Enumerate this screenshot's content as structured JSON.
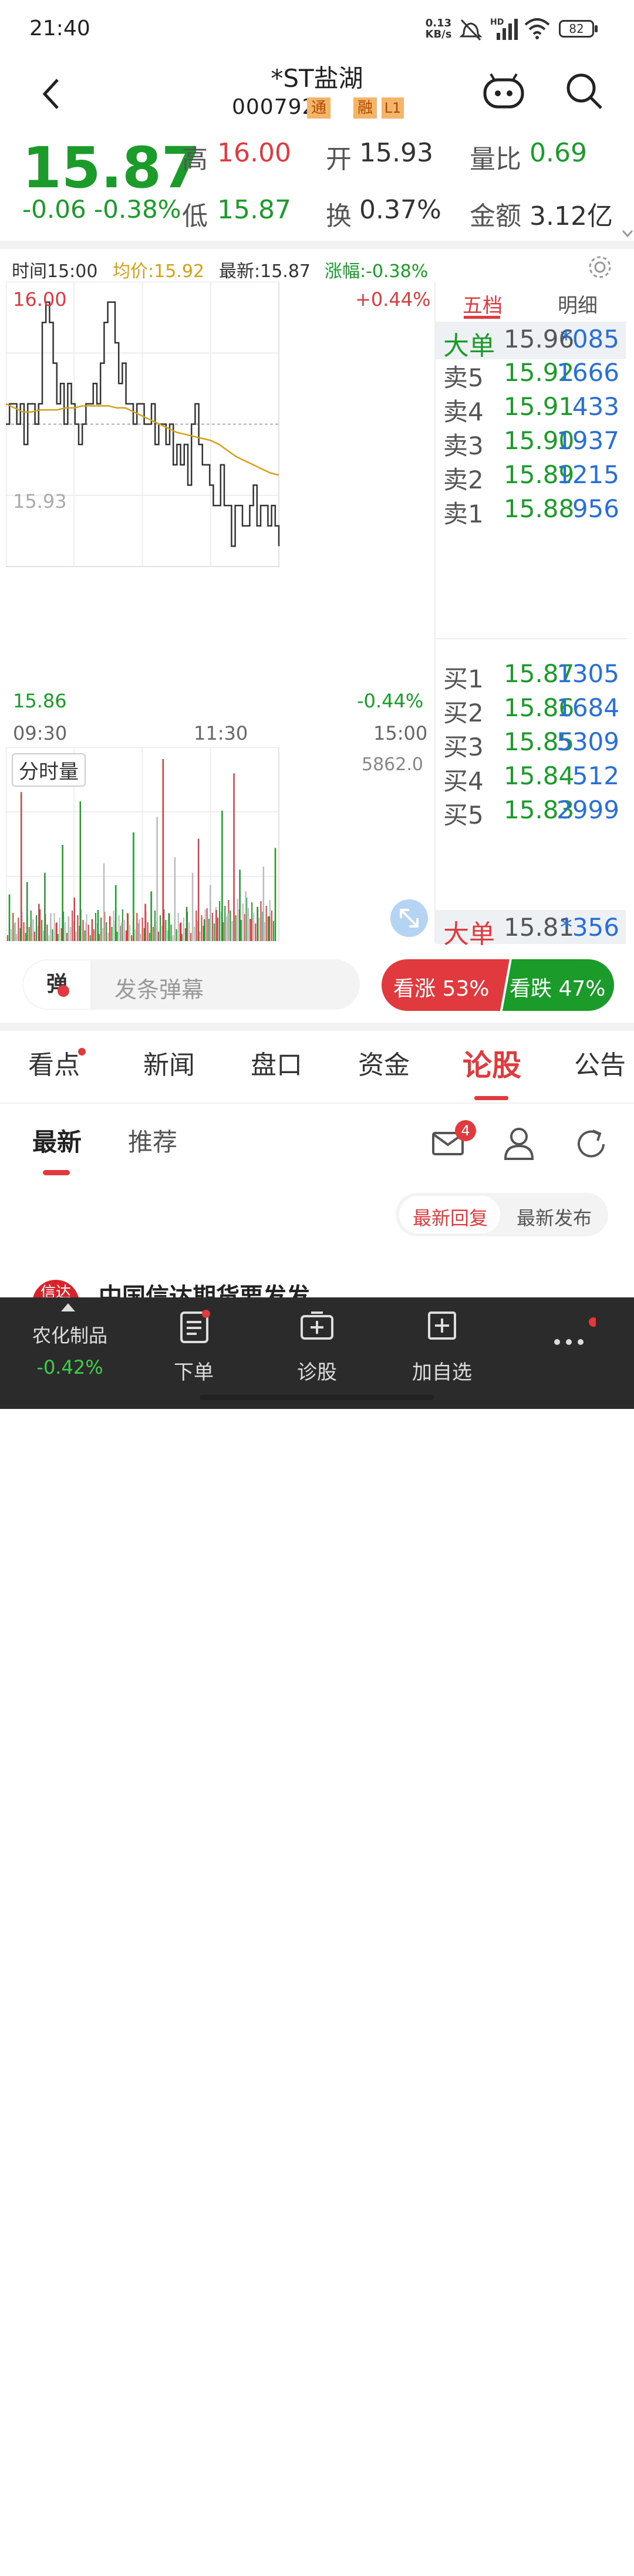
{
  "status": {
    "time": "21:40",
    "net_speed_top": "0.13",
    "net_speed_bottom": "KB/s",
    "hd": "HD",
    "battery": "82"
  },
  "header": {
    "title": "*ST盐湖",
    "code": "000792",
    "badge_tong": "通",
    "badge_rong": "融",
    "badge_level": "L1"
  },
  "quote": {
    "price": "15.87",
    "change": "-0.06",
    "change_pct": "-0.38%",
    "high_label": "高",
    "high_value": "16.00",
    "low_label": "低",
    "low_value": "15.87",
    "open_label": "开",
    "open_value": "15.93",
    "turnover_label": "换",
    "turnover_value": "0.37%",
    "vol_ratio_label": "量比",
    "vol_ratio_value": "0.69",
    "amount_label": "金额",
    "amount_value": "3.12亿"
  },
  "chart_info": {
    "time": "时间15:00",
    "avg": "均价:15.92",
    "latest": "最新:15.87",
    "change": "涨幅:-0.38%"
  },
  "chart_labels": {
    "y_top": "16.00",
    "y_bottom": "15.86",
    "pct_top": "+0.44%",
    "pct_bottom": "-0.44%",
    "prev_close": "15.93",
    "x_start": "09:30",
    "x_mid": "11:30",
    "x_end": "15:00",
    "volume_label": "分时量",
    "volume_max": "5862.0"
  },
  "chart_data": {
    "type": "line",
    "title": "",
    "x_ticks": [
      "09:30",
      "11:30",
      "15:00"
    ],
    "ylim": [
      15.86,
      16.0
    ],
    "prev_close": 15.93,
    "series": [
      {
        "name": "",
        "values": [
          15.93,
          15.94,
          15.94,
          15.93,
          15.94,
          15.92,
          15.94,
          15.94,
          15.93,
          15.94,
          15.98,
          15.99,
          15.98,
          15.96,
          15.94,
          15.95,
          15.93,
          15.95,
          15.94,
          15.93,
          15.92,
          15.93,
          15.94,
          15.94,
          15.95,
          15.94,
          15.96,
          15.98,
          15.99,
          15.99,
          15.97,
          15.95,
          15.96,
          15.94,
          15.94,
          15.93,
          15.94,
          15.94,
          15.93,
          15.93,
          15.94,
          15.92,
          15.93,
          15.93,
          15.92,
          15.93,
          15.91,
          15.92,
          15.91,
          15.92,
          15.9,
          15.93,
          15.94,
          15.92,
          15.91,
          15.91,
          15.9,
          15.89,
          15.89,
          15.91,
          15.89,
          15.89,
          15.87,
          15.89,
          15.89,
          15.88,
          15.88,
          15.89,
          15.9,
          15.88,
          15.89,
          15.89,
          15.88,
          15.89,
          15.88,
          15.87
        ]
      },
      {
        "name": "",
        "values": [
          15.94,
          15.938,
          15.936,
          15.936,
          15.937,
          15.937,
          15.937,
          15.938,
          15.938,
          15.939,
          15.939,
          15.939,
          15.939,
          15.938,
          15.938,
          15.936,
          15.934,
          15.932,
          15.93,
          15.928,
          15.926,
          15.925,
          15.924,
          15.923,
          15.922,
          15.92,
          15.917,
          15.914,
          15.912,
          15.91,
          15.908,
          15.906,
          15.905
        ]
      }
    ],
    "volume": [
      1500,
      600,
      4800,
      1900,
      700,
      1200,
      2200,
      900,
      600,
      3100,
      800,
      1400,
      4500,
      600,
      700,
      1000,
      2500,
      800,
      1800,
      600,
      900,
      3500,
      700,
      1200,
      1600,
      4000,
      5862,
      900,
      2700,
      600,
      1100,
      2200,
      3300,
      700,
      1800,
      1000,
      4200,
      900,
      5400,
      2300,
      1600,
      700,
      1100,
      2400,
      800,
      3000
    ]
  },
  "orderbook": {
    "tab_five": "五档",
    "tab_detail": "明细",
    "big_ask_label": "大单",
    "big_ask_price": "15.96",
    "big_ask_vol": "*085",
    "asks": [
      {
        "label": "卖5",
        "price": "15.92",
        "vol": "1666"
      },
      {
        "label": "卖4",
        "price": "15.91",
        "vol": "433"
      },
      {
        "label": "卖3",
        "price": "15.90",
        "vol": "1937"
      },
      {
        "label": "卖2",
        "price": "15.89",
        "vol": "1215"
      },
      {
        "label": "卖1",
        "price": "15.88",
        "vol": "956"
      }
    ],
    "bids": [
      {
        "label": "买1",
        "price": "15.87",
        "vol": "1305"
      },
      {
        "label": "买2",
        "price": "15.86",
        "vol": "1684"
      },
      {
        "label": "买3",
        "price": "15.85",
        "vol": "5309"
      },
      {
        "label": "买4",
        "price": "15.84",
        "vol": "512"
      },
      {
        "label": "买5",
        "price": "15.83",
        "vol": "2999"
      }
    ],
    "big_bid_label": "大单",
    "big_bid_price": "15.81",
    "big_bid_vol": "*356"
  },
  "danmu": {
    "badge": "弹",
    "placeholder": "发条弹幕",
    "rise_label": "看涨 53%",
    "fall_label": "看跌 47%",
    "rise_pct": 0.53
  },
  "tabs": [
    "看点",
    "新闻",
    "盘口",
    "资金",
    "论股",
    "公告"
  ],
  "subtabs": {
    "latest": "最新",
    "recommend": "推荐",
    "mail_count": "4",
    "reply": "最新回复",
    "publish": "最新发布"
  },
  "post_preview": {
    "title": "中国信达期货要发发",
    "avatar_text": "信达"
  },
  "bottom": {
    "sector_name": "农化制品",
    "sector_change": "-0.42%",
    "order": "下单",
    "diagnose": "诊股",
    "add_watch": "加自选"
  }
}
